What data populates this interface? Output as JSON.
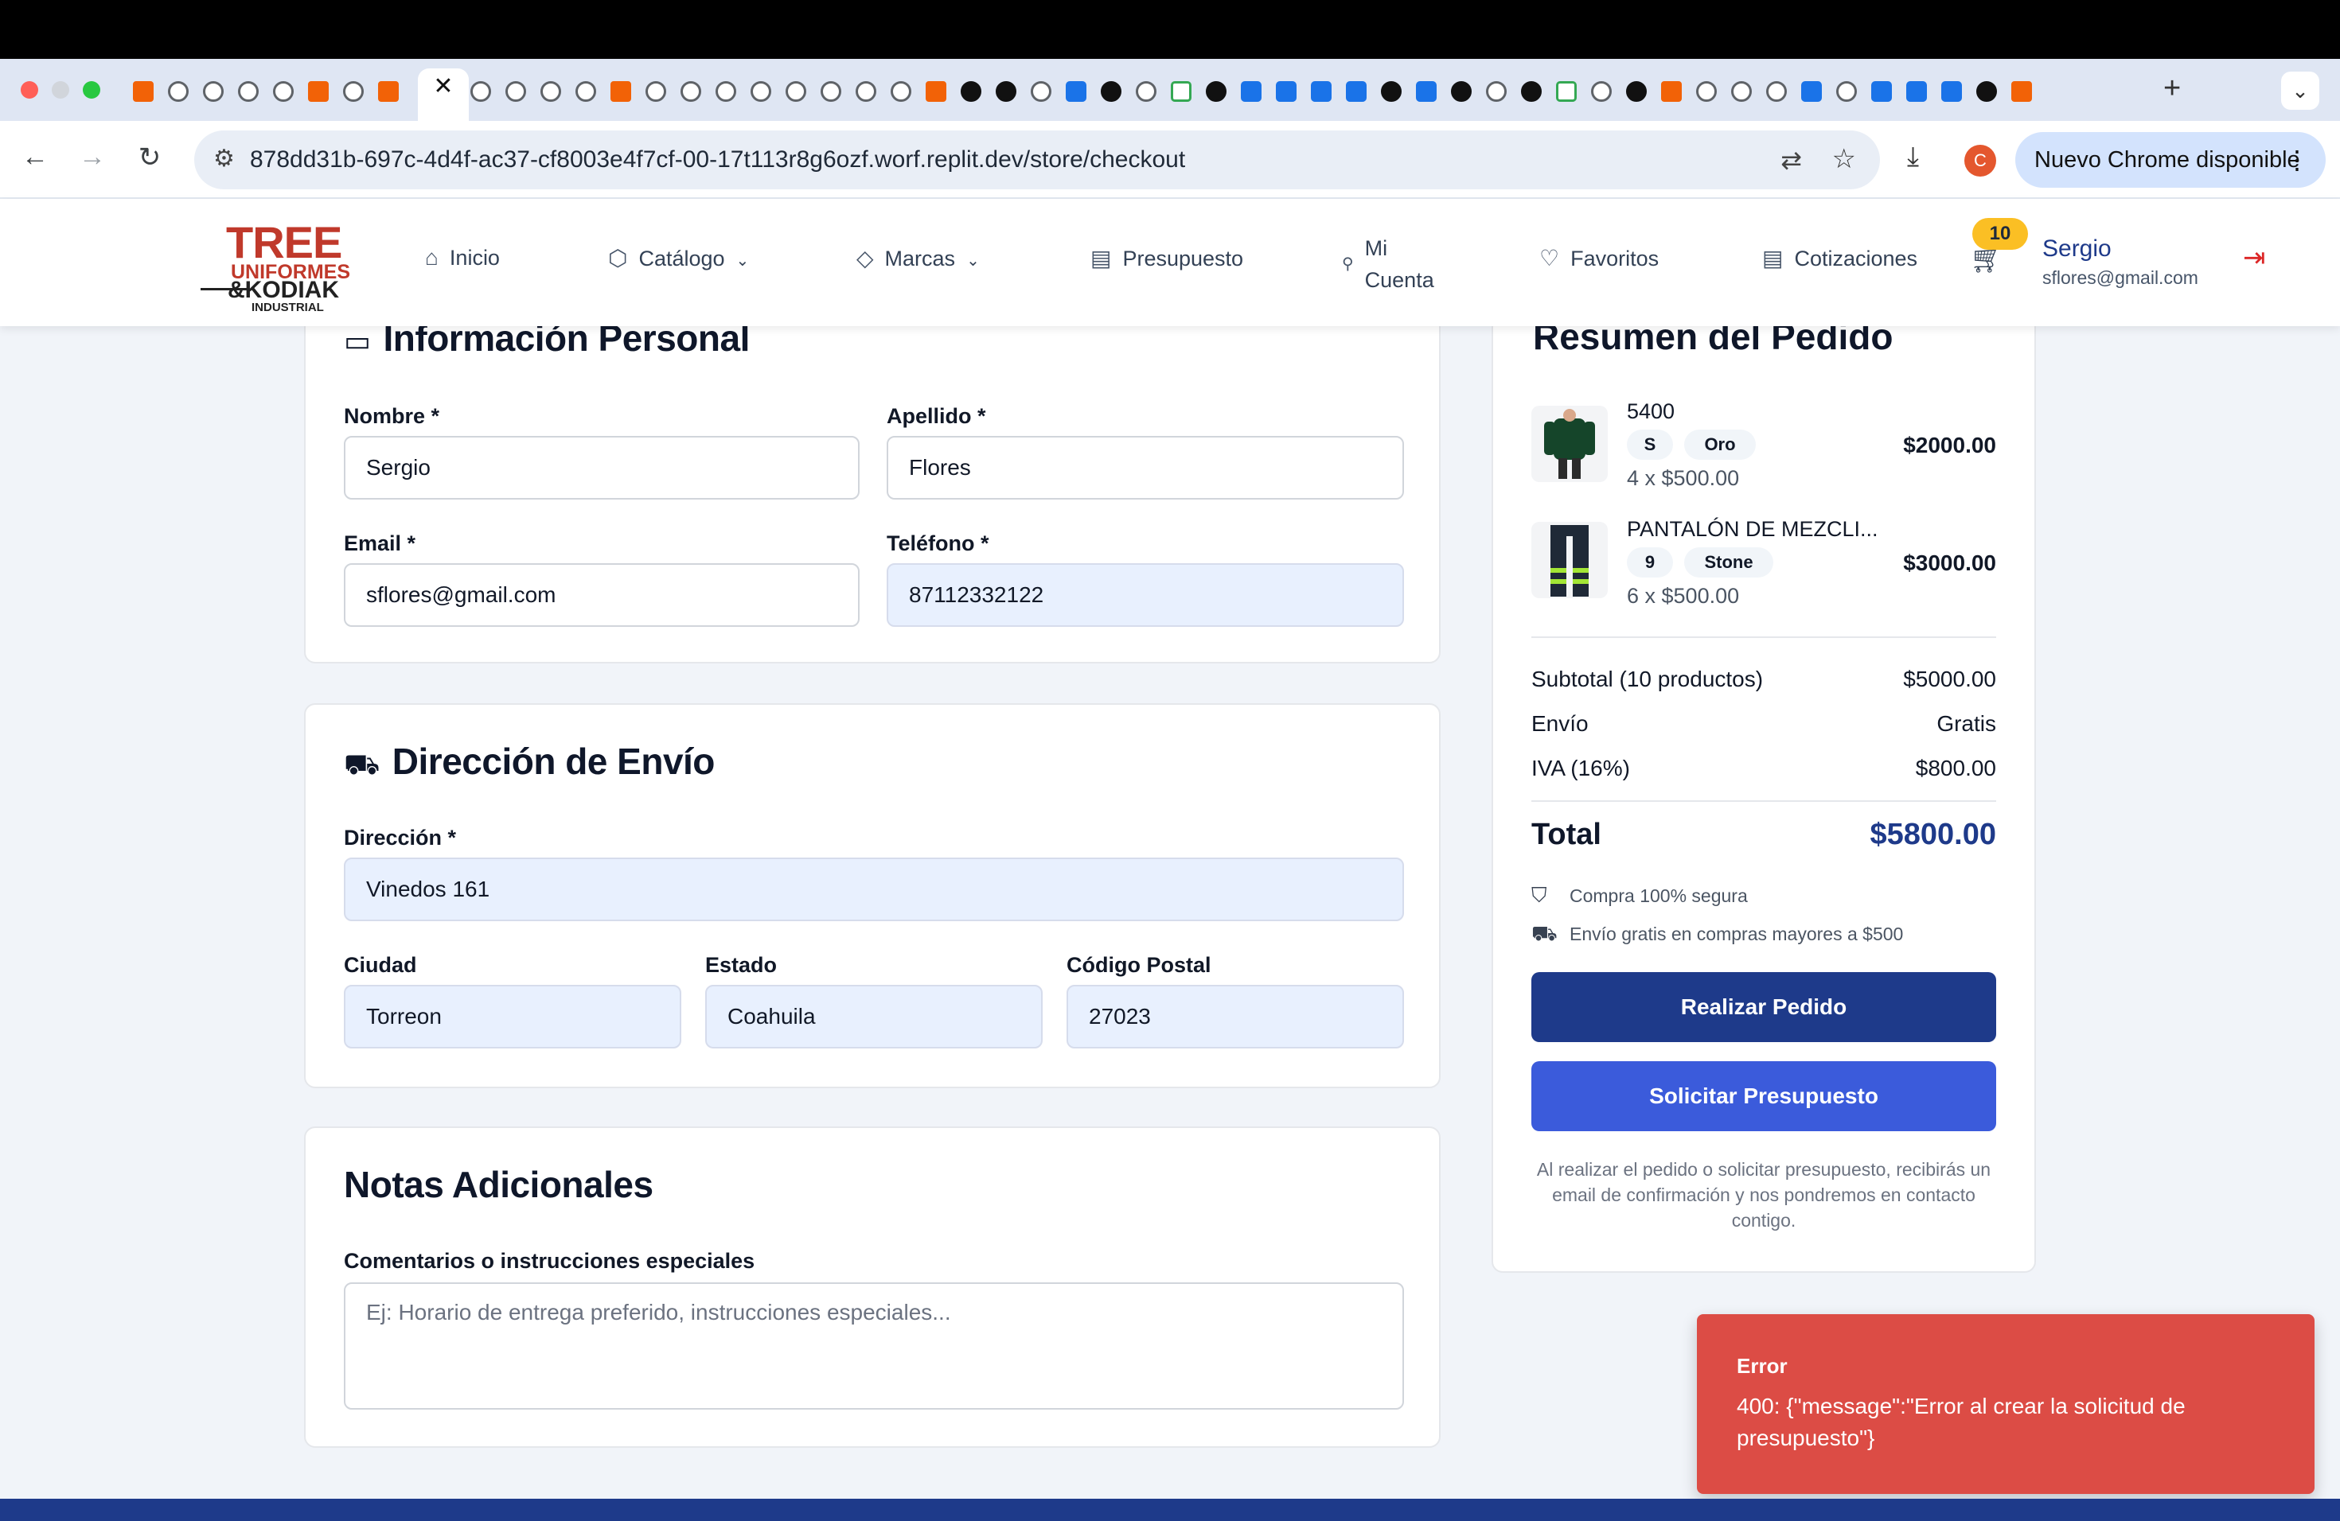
{
  "browser": {
    "url": "878dd31b-697c-4d4f-ac37-cf8003e4f7cf-00-17t113r8g6ozf.worf.replit.dev/store/checkout",
    "profile_initial": "C",
    "update_label": "Nuevo Chrome disponible",
    "active_tab_close": "✕",
    "new_tab": "+"
  },
  "site": {
    "logo": {
      "line1": "TREE",
      "line2": "UNIFORMES",
      "line3": "&KODIAK",
      "line4": "INDUSTRIAL"
    },
    "nav": [
      {
        "label": "Inicio",
        "icon": "home-icon"
      },
      {
        "label": "Catálogo",
        "icon": "box-icon"
      },
      {
        "label": "Marcas",
        "icon": "tag-icon"
      },
      {
        "label": "Presupuesto",
        "icon": "document-icon"
      },
      {
        "label_line1": "Mi",
        "label_line2": "Cuenta",
        "icon": "user-icon"
      },
      {
        "label": "Favoritos",
        "icon": "heart-icon"
      },
      {
        "label": "Cotizaciones",
        "icon": "document-icon"
      }
    ],
    "cart_count": "10",
    "user": {
      "name": "Sergio",
      "email": "sflores@gmail.com"
    }
  },
  "personal": {
    "title": "Información Personal",
    "nombre_label": "Nombre *",
    "nombre_value": "Sergio",
    "apellido_label": "Apellido *",
    "apellido_value": "Flores",
    "email_label": "Email *",
    "email_value": "sflores@gmail.com",
    "telefono_label": "Teléfono *",
    "telefono_value": "87112332122"
  },
  "shipping": {
    "title": "Dirección de Envío",
    "direccion_label": "Dirección *",
    "direccion_value": "Vinedos 161",
    "ciudad_label": "Ciudad",
    "ciudad_value": "Torreon",
    "estado_label": "Estado",
    "estado_value": "Coahuila",
    "cp_label": "Código Postal",
    "cp_value": "27023"
  },
  "notes": {
    "title": "Notas Adicionales",
    "label": "Comentarios o instrucciones especiales",
    "placeholder": "Ej: Horario de entrega preferido, instrucciones especiales..."
  },
  "summary": {
    "title": "Resumen del Pedido",
    "items": [
      {
        "name": "5400",
        "size": "S",
        "color": "Oro",
        "qty": "4 x $500.00",
        "price": "$2000.00"
      },
      {
        "name": "PANTALÓN DE MEZCLI...",
        "size": "9",
        "color": "Stone",
        "qty": "6 x $500.00",
        "price": "$3000.00"
      }
    ],
    "subtotal_label": "Subtotal (10 productos)",
    "subtotal_value": "$5000.00",
    "envio_label": "Envío",
    "envio_value": "Gratis",
    "iva_label": "IVA (16%)",
    "iva_value": "$800.00",
    "total_label": "Total",
    "total_value": "$5800.00",
    "secure_text": "Compra 100% segura",
    "free_ship_text": "Envío gratis en compras mayores a $500",
    "order_button": "Realizar Pedido",
    "quote_button": "Solicitar Presupuesto",
    "footnote": "Al realizar el pedido o solicitar presupuesto, recibirás un email de confirmación y nos pondremos en contacto contigo."
  },
  "toast": {
    "title": "Error",
    "message": "400: {\"message\":\"Error al crear la solicitud de presupuesto\"}"
  },
  "colors": {
    "primary": "#1e3a8a",
    "accent": "#3b5bdb",
    "error": "#dc4c45",
    "badge": "#fbbf24",
    "brand_red": "#c0392b"
  }
}
